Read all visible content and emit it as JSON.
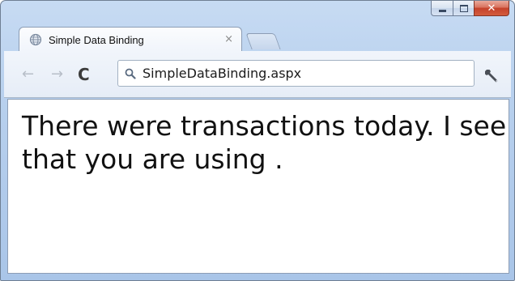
{
  "window": {
    "minimize_label": "Minimize",
    "maximize_label": "Maximize",
    "close_label": "Close"
  },
  "tab": {
    "title": "Simple Data Binding",
    "close_glyph": "×",
    "icon": "globe-icon"
  },
  "toolbar": {
    "back_glyph": "←",
    "forward_glyph": "→",
    "reload_glyph": "C",
    "wrench_icon": "wrench-icon"
  },
  "omnibox": {
    "url": "SimpleDataBinding.aspx",
    "icon": "search-icon"
  },
  "page": {
    "body_text": "There were transactions today. I see that you are using ."
  },
  "colors": {
    "frame": "#b9d1ee",
    "close_button": "#c4422b",
    "page_background": "#ffffff"
  }
}
